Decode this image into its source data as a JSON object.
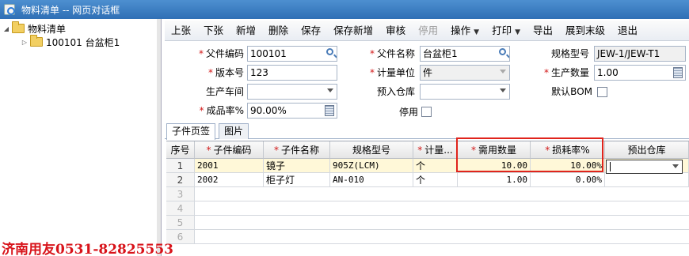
{
  "window": {
    "title": "物料清单 -- 网页对话框"
  },
  "tree": {
    "root": {
      "label": "物料清单",
      "toggle": "◢"
    },
    "child": {
      "label": "100101 台盆柜1",
      "toggle": "▷"
    }
  },
  "toolbar": {
    "buttons": [
      {
        "label": "上张",
        "disabled": false
      },
      {
        "label": "下张",
        "disabled": false
      },
      {
        "label": "新增",
        "disabled": false
      },
      {
        "label": "删除",
        "disabled": false
      },
      {
        "label": "保存",
        "disabled": false
      },
      {
        "label": "保存新增",
        "disabled": false
      },
      {
        "label": "审核",
        "disabled": false
      },
      {
        "label": "停用",
        "disabled": true
      },
      {
        "label": "操作",
        "disabled": false,
        "dropdown": true
      },
      {
        "label": "打印",
        "disabled": false,
        "dropdown": true
      },
      {
        "label": "导出",
        "disabled": false
      },
      {
        "label": "展到末级",
        "disabled": false
      },
      {
        "label": "退出",
        "disabled": false
      }
    ]
  },
  "form": {
    "parent_code": {
      "label": "父件编码",
      "value": "100101"
    },
    "parent_name": {
      "label": "父件名称",
      "value": "台盆柜1"
    },
    "spec_model": {
      "label": "规格型号",
      "value": "JEW-1/JEW-T1"
    },
    "version": {
      "label": "版本号",
      "value": "123"
    },
    "unit": {
      "label": "计量单位",
      "value": "件"
    },
    "prod_qty": {
      "label": "生产数量",
      "value": "1.00"
    },
    "workshop": {
      "label": "生产车间",
      "value": ""
    },
    "pre_warehouse": {
      "label": "预入仓库",
      "value": ""
    },
    "default_bom": {
      "label": "默认BOM"
    },
    "yield_rate": {
      "label": "成品率%",
      "value": "90.00%"
    },
    "disabled": {
      "label": "停用"
    }
  },
  "tabs": [
    "子件页签",
    "图片"
  ],
  "grid": {
    "headers": [
      "序号",
      "子件编码",
      "子件名称",
      "规格型号",
      "计量...",
      "需用数量",
      "损耗率%",
      "预出仓库"
    ],
    "required": [
      false,
      true,
      true,
      false,
      true,
      true,
      true,
      false
    ],
    "rows": [
      {
        "no": "1",
        "code": "2001",
        "name": "镜子",
        "spec": "905Z(LCM)",
        "unit": "个",
        "qty": "10.00",
        "loss": "10.00%",
        "wh": ""
      },
      {
        "no": "2",
        "code": "2002",
        "name": "柜子灯",
        "spec": "AN-010",
        "unit": "个",
        "qty": "1.00",
        "loss": "0.00%",
        "wh": ""
      }
    ],
    "empty_rows": [
      "3",
      "4",
      "5",
      "6"
    ]
  },
  "watermark": "济南用友0531-82825553",
  "colors": {
    "required": "#d21818",
    "highlight_box": "#e0241c",
    "title_bar": "#3a7cc4"
  }
}
